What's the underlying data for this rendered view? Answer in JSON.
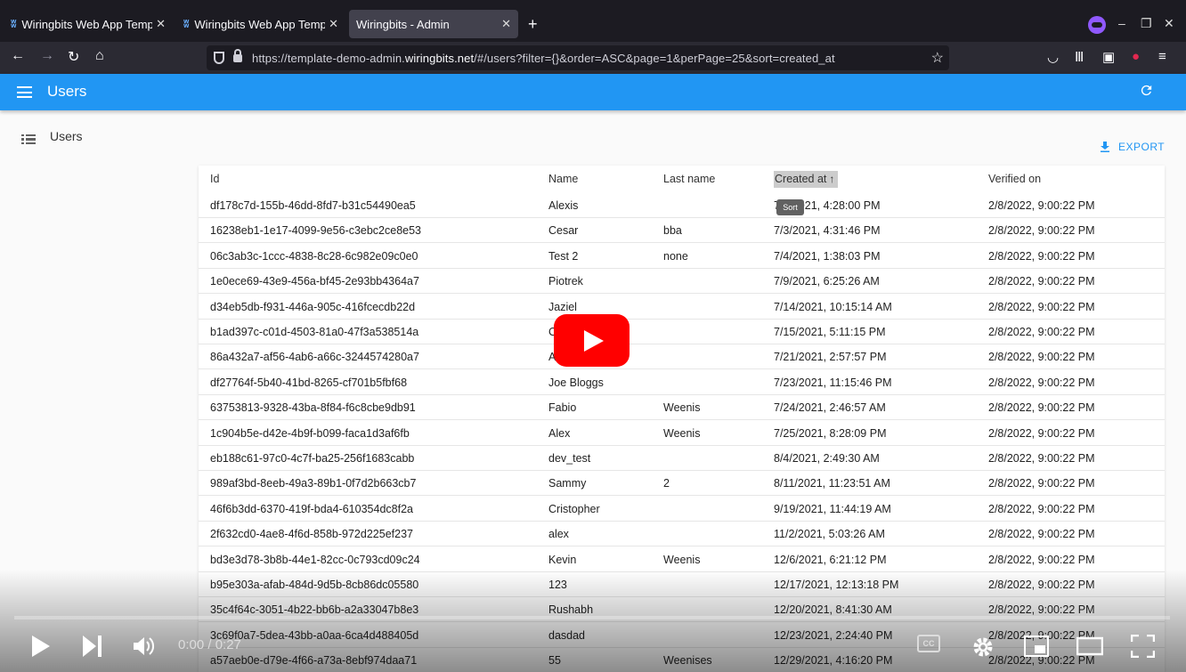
{
  "browser": {
    "tabs": [
      {
        "title": "Wiringbits Web App Temp",
        "active": false
      },
      {
        "title": "Wiringbits Web App Temp",
        "active": false
      },
      {
        "title": "Wiringbits - Admin",
        "active": true
      }
    ],
    "url_prefix": "https://template-demo-admin.",
    "url_domain": "wiringbits.net",
    "url_suffix": "/#/users?filter={}&order=ASC&page=1&perPage=25&sort=created_at"
  },
  "appbar": {
    "title": "Users"
  },
  "sidebar": {
    "items": [
      {
        "label": "Users"
      }
    ]
  },
  "toolbar": {
    "export_label": "EXPORT"
  },
  "table": {
    "columns": [
      "Id",
      "Name",
      "Last name",
      "Created at",
      "Verified on"
    ],
    "sorted_column": "Created at",
    "sort_tooltip": "Sort",
    "rows": [
      {
        "id": "df178c7d-155b-46dd-8fd7-b31c54490ea5",
        "name": "Alexis",
        "last": "",
        "created": "7/3/2021, 4:28:00 PM",
        "verified": "2/8/2022, 9:00:22 PM"
      },
      {
        "id": "16238eb1-1e17-4099-9e56-c3ebc2ce8e53",
        "name": "Cesar",
        "last": "bba",
        "created": "7/3/2021, 4:31:46 PM",
        "verified": "2/8/2022, 9:00:22 PM"
      },
      {
        "id": "06c3ab3c-1ccc-4838-8c28-6c982e09c0e0",
        "name": "Test 2",
        "last": "none",
        "created": "7/4/2021, 1:38:03 PM",
        "verified": "2/8/2022, 9:00:22 PM"
      },
      {
        "id": "1e0ece69-43e9-456a-bf45-2e93bb4364a7",
        "name": "Piotrek",
        "last": "",
        "created": "7/9/2021, 6:25:26 AM",
        "verified": "2/8/2022, 9:00:22 PM"
      },
      {
        "id": "d34eb5db-f931-446a-905c-416fcecdb22d",
        "name": "Jaziel",
        "last": "",
        "created": "7/14/2021, 10:15:14 AM",
        "verified": "2/8/2022, 9:00:22 PM"
      },
      {
        "id": "b1ad397c-c01d-4503-81a0-47f3a538514a",
        "name": "C",
        "last": "",
        "created": "7/15/2021, 5:11:15 PM",
        "verified": "2/8/2022, 9:00:22 PM"
      },
      {
        "id": "86a432a7-af56-4ab6-a66c-3244574280a7",
        "name": "A",
        "last": "",
        "created": "7/21/2021, 2:57:57 PM",
        "verified": "2/8/2022, 9:00:22 PM"
      },
      {
        "id": "df27764f-5b40-41bd-8265-cf701b5fbf68",
        "name": "Joe Bloggs",
        "last": "",
        "created": "7/23/2021, 11:15:46 PM",
        "verified": "2/8/2022, 9:00:22 PM"
      },
      {
        "id": "63753813-9328-43ba-8f84-f6c8cbe9db91",
        "name": "Fabio",
        "last": "Weenis",
        "created": "7/24/2021, 2:46:57 AM",
        "verified": "2/8/2022, 9:00:22 PM"
      },
      {
        "id": "1c904b5e-d42e-4b9f-b099-faca1d3af6fb",
        "name": "Alex",
        "last": "Weenis",
        "created": "7/25/2021, 8:28:09 PM",
        "verified": "2/8/2022, 9:00:22 PM"
      },
      {
        "id": "eb188c61-97c0-4c7f-ba25-256f1683cabb",
        "name": "dev_test",
        "last": "",
        "created": "8/4/2021, 2:49:30 AM",
        "verified": "2/8/2022, 9:00:22 PM"
      },
      {
        "id": "989af3bd-8eeb-49a3-89b1-0f7d2b663cb7",
        "name": "Sammy",
        "last": "2",
        "created": "8/11/2021, 11:23:51 AM",
        "verified": "2/8/2022, 9:00:22 PM"
      },
      {
        "id": "46f6b3dd-6370-419f-bda4-610354dc8f2a",
        "name": "Cristopher",
        "last": "",
        "created": "9/19/2021, 11:44:19 AM",
        "verified": "2/8/2022, 9:00:22 PM"
      },
      {
        "id": "2f632cd0-4ae8-4f6d-858b-972d225ef237",
        "name": "alex",
        "last": "",
        "created": "11/2/2021, 5:03:26 AM",
        "verified": "2/8/2022, 9:00:22 PM"
      },
      {
        "id": "bd3e3d78-3b8b-44e1-82cc-0c793cd09c24",
        "name": "Kevin",
        "last": "Weenis",
        "created": "12/6/2021, 6:21:12 PM",
        "verified": "2/8/2022, 9:00:22 PM"
      },
      {
        "id": "b95e303a-afab-484d-9d5b-8cb86dc05580",
        "name": "123",
        "last": "",
        "created": "12/17/2021, 12:13:18 PM",
        "verified": "2/8/2022, 9:00:22 PM"
      },
      {
        "id": "35c4f64c-3051-4b22-bb6b-a2a33047b8e3",
        "name": "Rushabh",
        "last": "",
        "created": "12/20/2021, 8:41:30 AM",
        "verified": "2/8/2022, 9:00:22 PM"
      },
      {
        "id": "3c69f0a7-5dea-43bb-a0aa-6ca4d488405d",
        "name": "dasdad",
        "last": "",
        "created": "12/23/2021, 2:24:40 PM",
        "verified": "2/8/2022, 9:00:22 PM"
      },
      {
        "id": "a57aeb0e-d79e-4f66-a73a-8ebf974daa71",
        "name": "55",
        "last": "Weenises",
        "created": "12/29/2021, 4:16:20 PM",
        "verified": "2/8/2022, 9:00:22 PM"
      }
    ]
  },
  "video": {
    "time_display": "0:00 / 0:27",
    "cc_label": "CC",
    "progress": 0
  }
}
